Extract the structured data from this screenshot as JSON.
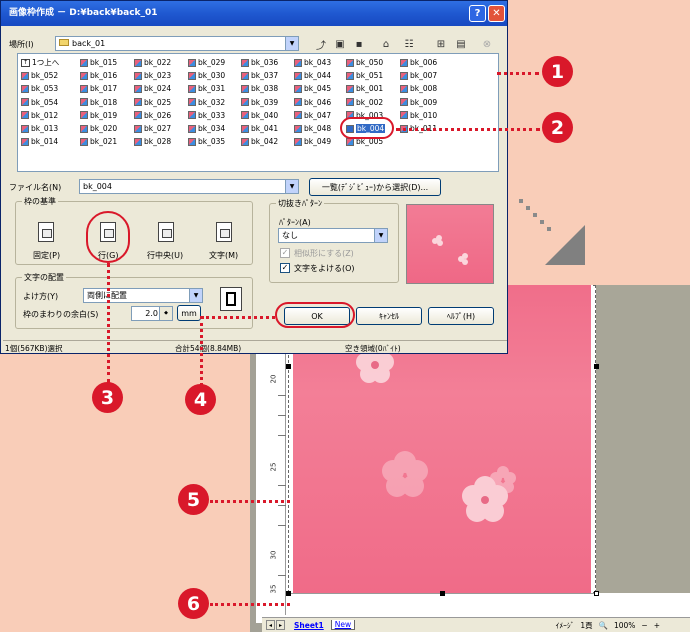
{
  "dialog": {
    "title": "画像枠作成 － D:¥back¥back_01",
    "help_glyph": "?",
    "close_glyph": "✕",
    "location_label": "場所(I)",
    "location_value": "back_01",
    "file_columns": [
      [
        "1つ上へ",
        "bk_052",
        "bk_053",
        "bk_054",
        "bk_012",
        "bk_013",
        "bk_014"
      ],
      [
        "bk_015",
        "bk_016",
        "bk_017",
        "bk_018",
        "bk_019",
        "bk_020",
        "bk_021"
      ],
      [
        "bk_022",
        "bk_023",
        "bk_024",
        "bk_025",
        "bk_026",
        "bk_027",
        "bk_028"
      ],
      [
        "bk_029",
        "bk_030",
        "bk_031",
        "bk_032",
        "bk_033",
        "bk_034",
        "bk_035"
      ],
      [
        "bk_036",
        "bk_037",
        "bk_038",
        "bk_039",
        "bk_040",
        "bk_041",
        "bk_042"
      ],
      [
        "bk_043",
        "bk_044",
        "bk_045",
        "bk_046",
        "bk_047",
        "bk_048",
        "bk_049"
      ],
      [
        "bk_050",
        "bk_051",
        "bk_001",
        "bk_002",
        "bk_003",
        "bk_004",
        "bk_005"
      ],
      [
        "bk_006",
        "bk_007",
        "bk_008",
        "bk_009",
        "bk_010",
        "bk_011"
      ]
    ],
    "selected_file": "bk_004",
    "filename_label": "ファイル名(N)",
    "filename_value": "bk_004",
    "list_select_button": "一覧(ﾃﾞｼﾞﾋﾞｭｰ)から選択(D)...",
    "frame_basis": {
      "title": "枠の基準",
      "options": [
        "固定(P)",
        "行(G)",
        "行中央(U)",
        "文字(M)"
      ],
      "selected": "行(G)"
    },
    "text_layout": {
      "title": "文字の配置",
      "align_label": "よけ方(Y)",
      "align_value": "両側に配置",
      "margin_label": "枠のまわりの余白(S)",
      "margin_value": "2.0",
      "unit": "mm"
    },
    "clip_pattern": {
      "title": "切抜きﾊﾟﾀｰﾝ",
      "pattern_label": "ﾊﾟﾀｰﾝ(A)",
      "pattern_value": "なし",
      "similar_label": "相似形にする(Z)",
      "wrap_label": "文字をよける(O)",
      "check_glyph": "✓"
    },
    "buttons": {
      "ok": "OK",
      "cancel": "ｷｬﾝｾﾙ",
      "help": "ﾍﾙﾌﾟ(H)"
    },
    "status": {
      "selection": "1個(567KB)選択",
      "total": "合計54個(8.84MB)",
      "free": "空き領域(0ﾊﾞｲﾄ)"
    }
  },
  "sheet": {
    "ruler_numbers": [
      "20",
      "25",
      "30",
      "35"
    ],
    "tabs": [
      "Sheet1",
      "New"
    ],
    "status_image": "ｲﾒｰｼﾞ",
    "status_page": "1頁",
    "status_zoom": "100%"
  },
  "callouts": [
    "1",
    "2",
    "3",
    "4",
    "5",
    "6"
  ],
  "colors": {
    "callout": "#d9182a",
    "title_bar": "#1f58d0",
    "pink_paper": "#f06e8a",
    "background": "#f9cdb8"
  }
}
